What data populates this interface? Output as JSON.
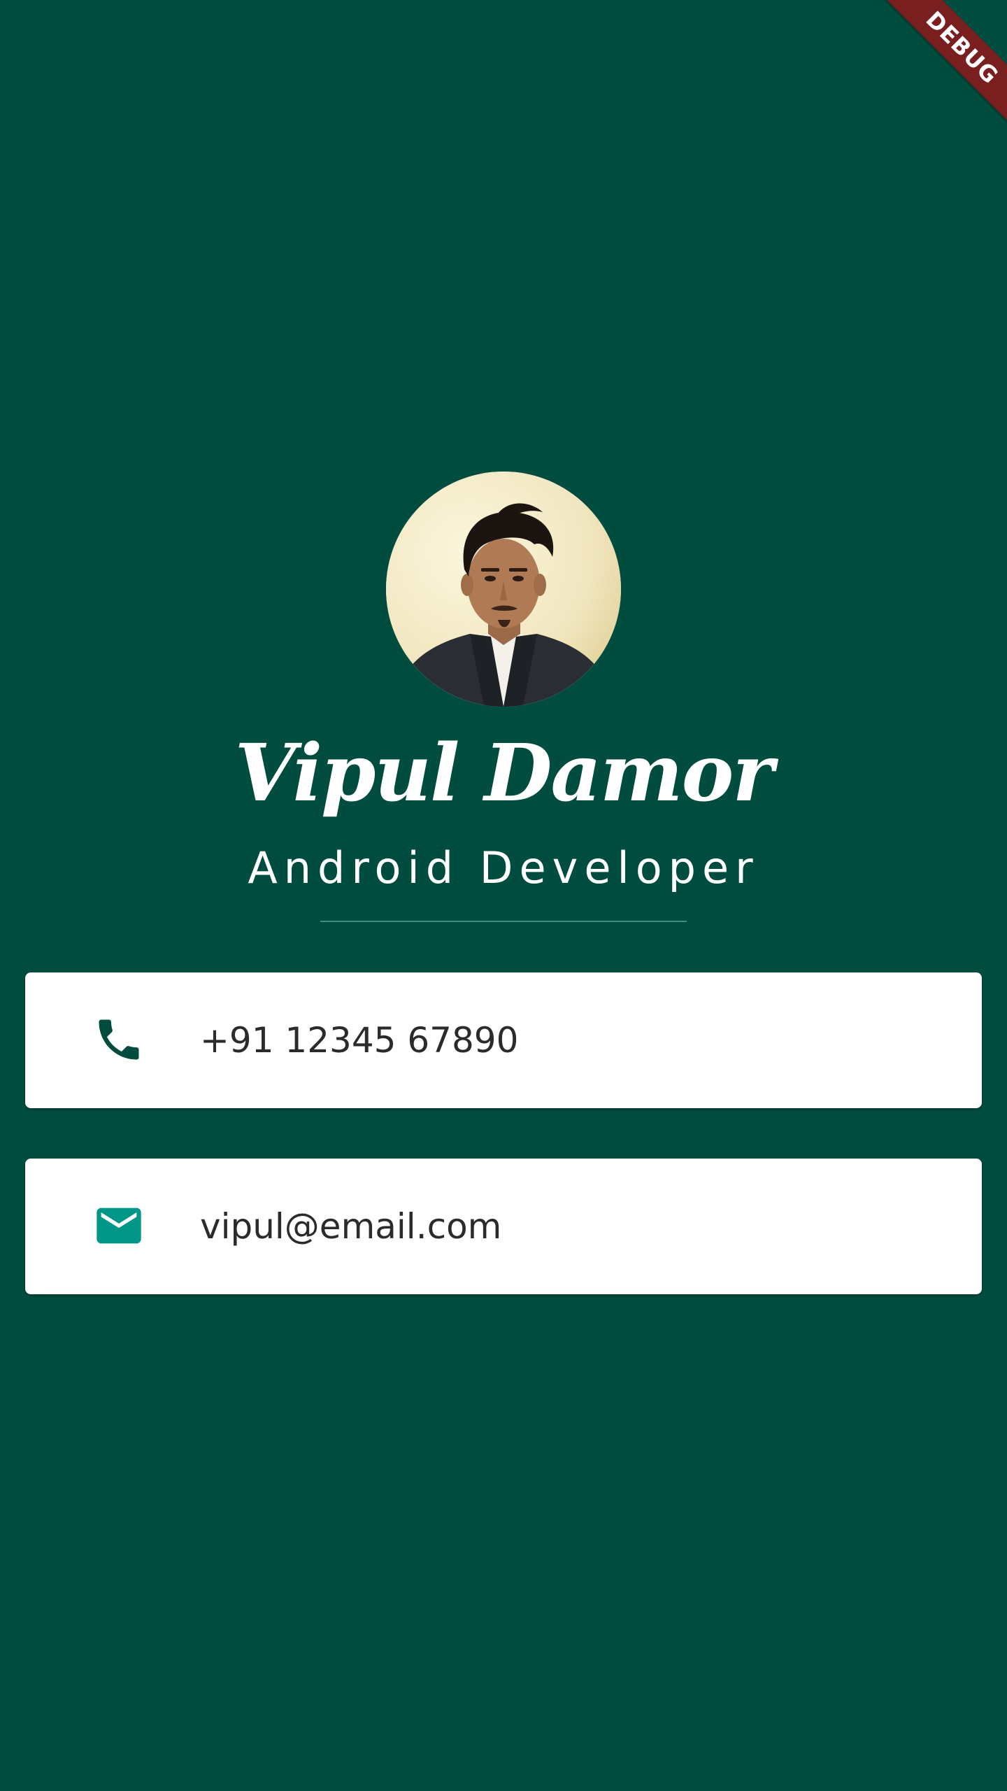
{
  "debug_banner": {
    "label": "DEBUG"
  },
  "profile": {
    "name": "Vipul Damor",
    "title": "Android Developer"
  },
  "contacts": {
    "phone": {
      "icon": "phone-icon",
      "value": "+91 12345 67890"
    },
    "email": {
      "icon": "mail-icon",
      "value": "vipul@email.com"
    }
  },
  "colors": {
    "background": "#004d40",
    "card": "#ffffff",
    "phone_icon": "#004d40",
    "mail_icon": "#009688",
    "debug_banner": "#7a1f1f"
  }
}
